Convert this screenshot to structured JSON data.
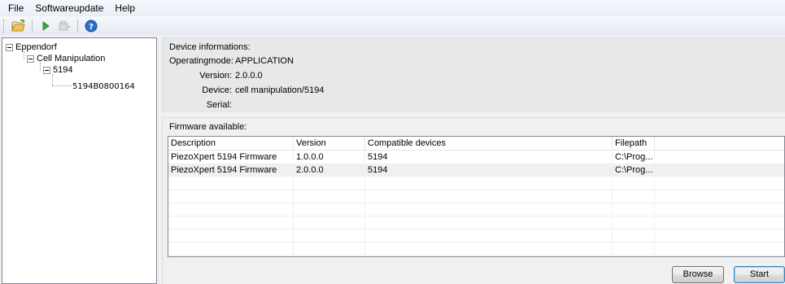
{
  "menu": {
    "items": [
      "File",
      "Softwareupdate",
      "Help"
    ]
  },
  "toolbar": {
    "icons": [
      "open-folder-icon",
      "play-icon",
      "connect-icon",
      "help-icon"
    ]
  },
  "tree": {
    "root": "Eppendorf",
    "child": "Cell Manipulation",
    "grandchild": "5194",
    "leaf": "5194B0800164"
  },
  "device_info": {
    "title": "Device informations:",
    "operatingmode_label": "Operatingmode:",
    "operatingmode_value": "APPLICATION",
    "version_label": "Version:",
    "version_value": "2.0.0.0",
    "device_label": "Device:",
    "device_value": "cell manipulation/5194",
    "serial_label": "Serial:",
    "serial_value": ""
  },
  "firmware": {
    "title": "Firmware available:",
    "columns": [
      "Description",
      "Version",
      "Compatible devices",
      "Filepath"
    ],
    "rows": [
      {
        "description": "PiezoXpert 5194 Firmware",
        "version": "1.0.0.0",
        "compatible": "5194",
        "filepath": "C:\\Prog..."
      },
      {
        "description": "PiezoXpert 5194 Firmware",
        "version": "2.0.0.0",
        "compatible": "5194",
        "filepath": "C:\\Prog..."
      }
    ]
  },
  "buttons": {
    "browse": "Browse",
    "start": "Start"
  },
  "colors": {
    "selected_row": "#f0f0f0",
    "default_button_border": "#3c7fb1"
  }
}
